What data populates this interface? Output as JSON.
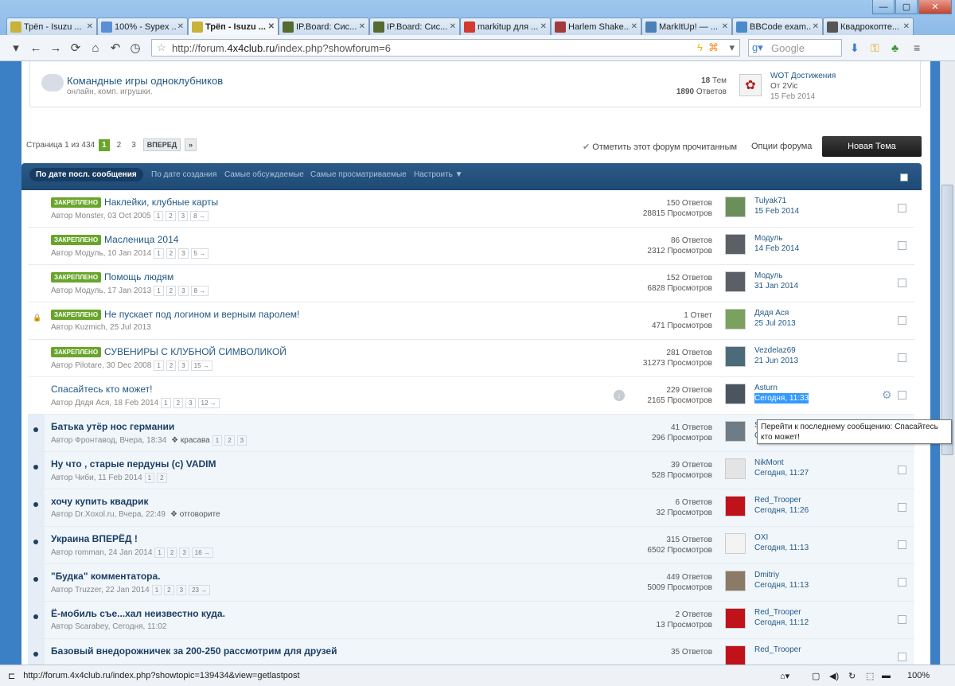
{
  "window": {
    "controls": [
      "—",
      "▢",
      "✕"
    ]
  },
  "tabs": [
    {
      "label": "Трёп - Isuzu ...",
      "color": "#c9b23b"
    },
    {
      "label": "100% - Sypex ...",
      "color": "#5a8fd6"
    },
    {
      "label": "Трёп - Isuzu ...",
      "color": "#c9b23b",
      "active": true
    },
    {
      "label": "IP.Board: Сис...",
      "color": "#556b2f"
    },
    {
      "label": "IP.Board: Сис...",
      "color": "#556b2f"
    },
    {
      "label": "markitup для ...",
      "color": "#d43a2f"
    },
    {
      "label": "Harlem Shake...",
      "color": "#a13b3b"
    },
    {
      "label": "MarkItUp! — ...",
      "color": "#4d7fb8"
    },
    {
      "label": "BBCode exam...",
      "color": "#4c89c9"
    },
    {
      "label": "Квадрокопте...",
      "color": "#555"
    }
  ],
  "nav": {
    "url_prefix": "http://forum.",
    "url_domain": "4x4club.ru",
    "url_path": "/index.php?showforum=6",
    "search_placeholder": "Google"
  },
  "forum_box": {
    "title": "Командные игры одноклубников",
    "desc": "онлайн, комп. игрушки.",
    "topics_count": "18",
    "topics_label": "Тем",
    "replies_count": "1890",
    "replies_label": "Ответов",
    "last_title": "WOT Достижения",
    "last_by": "От 2Vic",
    "last_date": "15 Feb 2014"
  },
  "pager": {
    "label": "Страница 1 из 434",
    "pages": [
      "1",
      "2",
      "3"
    ],
    "next": "ВПЕРЕД",
    "last": "»"
  },
  "actions": {
    "mark_read": "Отметить этот форум прочитанным",
    "options": "Опции форума",
    "new_topic": "Новая Тема"
  },
  "filters": [
    "По дате посл. сообщения",
    "По дате создания",
    "Самые обсуждаемые",
    "Самые просматриваемые",
    "Настроить ▼"
  ],
  "topics": [
    {
      "pinned": true,
      "badge": "ЗАКРЕПЛЕНО",
      "title": "Наклейки, клубные карты",
      "meta": "Автор Monster, 03 Oct 2005",
      "pages": [
        "1",
        "2",
        "3",
        "8 →"
      ],
      "replies": "150 Ответов",
      "views": "28815 Просмотров",
      "last_user": "Tulyak71",
      "last_date": "15 Feb 2014",
      "avatar": "#6b8f5a"
    },
    {
      "pinned": true,
      "badge": "ЗАКРЕПЛЕНО",
      "title": "Масленица 2014",
      "meta": "Автор Модуль, 10 Jan 2014",
      "pages": [
        "1",
        "2",
        "3",
        "5 →"
      ],
      "replies": "86 Ответов",
      "views": "2312 Просмотров",
      "last_user": "Модуль",
      "last_date": "14 Feb 2014",
      "avatar": "#5b6066"
    },
    {
      "pinned": true,
      "badge": "ЗАКРЕПЛЕНО",
      "title": "Помощь людям",
      "meta": "Автор Модуль, 17 Jan 2013",
      "pages": [
        "1",
        "2",
        "3",
        "8 →"
      ],
      "replies": "152 Ответов",
      "views": "6828 Просмотров",
      "last_user": "Модуль",
      "last_date": "31 Jan 2014",
      "avatar": "#5b6066"
    },
    {
      "pinned": true,
      "locked": true,
      "badge": "ЗАКРЕПЛЕНО",
      "title": "Не пускает под логином и верным паролем!",
      "meta": "Автор Kuzmich, 25 Jul 2013",
      "pages": [],
      "replies": "1 Ответ",
      "views": "471 Просмотров",
      "last_user": "Дядя Ася",
      "last_date": "25 Jul 2013",
      "avatar": "#7aa15d"
    },
    {
      "pinned": true,
      "badge": "ЗАКРЕПЛЕНО",
      "title": "СУВЕНИРЫ С КЛУБНОЙ СИМВОЛИКОЙ",
      "meta": "Автор Pilotare, 30 Dec 2008",
      "pages": [
        "1",
        "2",
        "3",
        "15 →"
      ],
      "replies": "281 Ответов",
      "views": "31273 Просмотров",
      "last_user": "Vezdelaz69",
      "last_date": "21 Jun 2013",
      "avatar": "#4c6b7a"
    },
    {
      "title": "Спасайтесь кто может!",
      "meta": "Автор Дядя Ася, 18 Feb 2014",
      "pages": [
        "1",
        "2",
        "3",
        "12 →"
      ],
      "replies": "229 Ответов",
      "views": "2165 Просмотров",
      "last_user": "Asturn",
      "last_date": "Сегодня, 11:33",
      "avatar": "#4a5560",
      "highlight": true
    },
    {
      "unread": true,
      "title": "Батька утёр нос германии",
      "meta": "Автор Фронтавод, Вчера, 18:34",
      "tag": "красава",
      "pages": [
        "1",
        "2",
        "3"
      ],
      "replies": "41 Ответов",
      "views": "296 Просмотров",
      "last_user": "Scara",
      "last_date": "Сегодня, 11:31",
      "avatar": "#6e7c88"
    },
    {
      "unread": true,
      "title": "Ну что , старые пердуны (с) VADIM",
      "meta": "Автор Чиби, 11 Feb 2014",
      "pages": [
        "1",
        "2"
      ],
      "replies": "39 Ответов",
      "views": "528 Просмотров",
      "last_user": "NikMont",
      "last_date": "Сегодня, 11:27",
      "avatar": "#e4e4e4"
    },
    {
      "unread": true,
      "title": "хочу купить квадрик",
      "meta": "Автор Dr.Xoxol.ru, Вчера, 22:49",
      "tag": "отговорите",
      "pages": [],
      "replies": "6 Ответов",
      "views": "32 Просмотров",
      "last_user": "Red_Trooper",
      "last_date": "Сегодня, 11:26",
      "avatar": "#c0121b"
    },
    {
      "unread": true,
      "title": "Украина ВПЕРЁД !",
      "meta": "Автор romman, 24 Jan 2014",
      "pages": [
        "1",
        "2",
        "3",
        "16 →"
      ],
      "replies": "315 Ответов",
      "views": "6502 Просмотров",
      "last_user": "OXI",
      "last_date": "Сегодня, 11:13",
      "avatar": "#f3f3f3"
    },
    {
      "unread": true,
      "title": "\"Будка\" комментатора.",
      "meta": "Автор Truzzer, 22 Jan 2014",
      "pages": [
        "1",
        "2",
        "3",
        "23 →"
      ],
      "replies": "449 Ответов",
      "views": "5009 Просмотров",
      "last_user": "Dmitriy",
      "last_date": "Сегодня, 11:13",
      "avatar": "#8a7a66"
    },
    {
      "unread": true,
      "title": "Ё-мобиль съе...хал неизвестно куда.",
      "meta": "Автор Scarabey, Сегодня, 11:02",
      "pages": [],
      "replies": "2 Ответов",
      "views": "13 Просмотров",
      "last_user": "Red_Trooper",
      "last_date": "Сегодня, 11:12",
      "avatar": "#c0121b"
    },
    {
      "unread": true,
      "title": "Базовый внедорожничек за 200-250 рассмотрим для друзей",
      "meta": "",
      "pages": [],
      "replies": "35 Ответов",
      "views": "",
      "last_user": "Red_Trooper",
      "last_date": "",
      "avatar": "#c0121b"
    }
  ],
  "tooltip": "Перейти к последнему сообщению: Спасайтесь кто может!",
  "status": {
    "url": "http://forum.4x4club.ru/index.php?showtopic=139434&view=getlastpost",
    "zoom": "100%"
  }
}
